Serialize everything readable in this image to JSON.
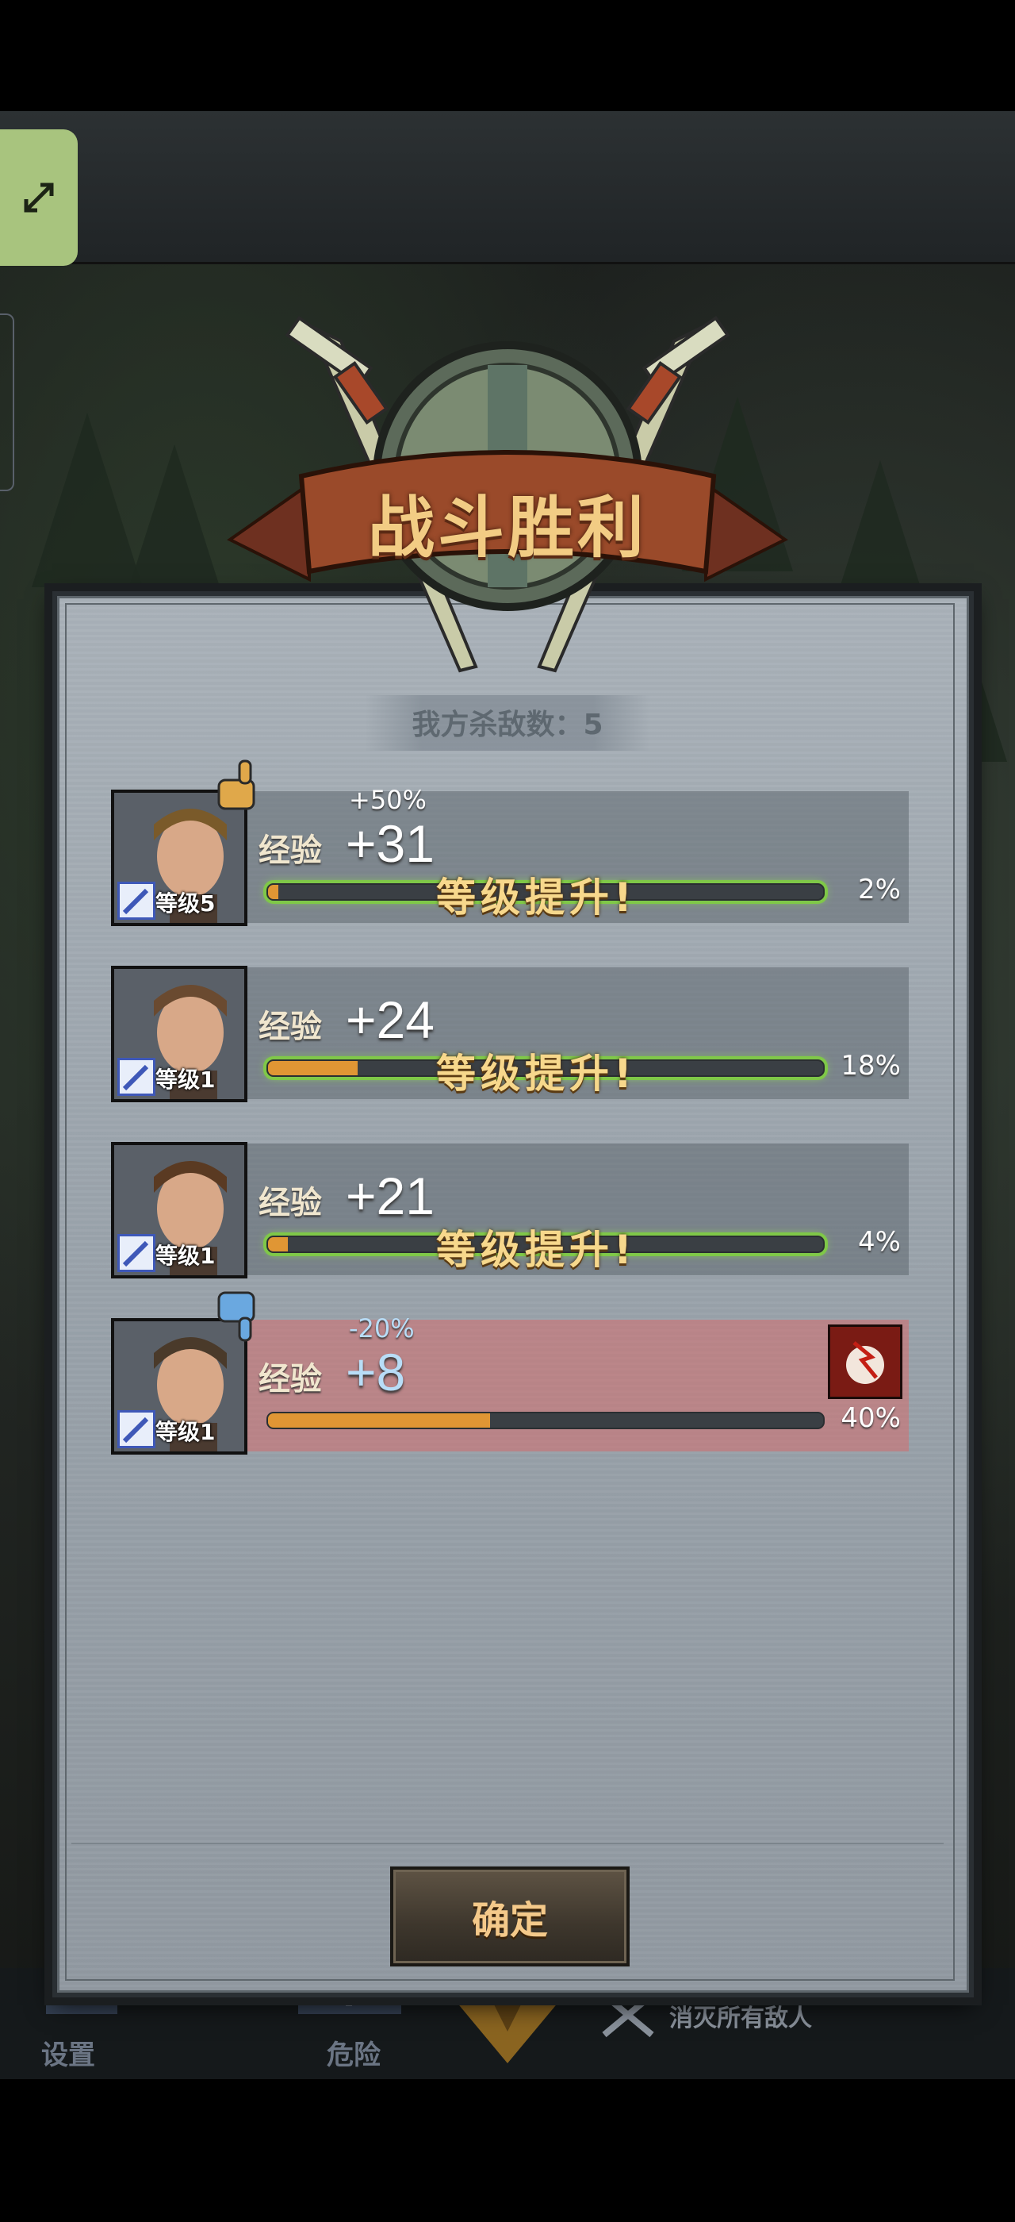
{
  "title": "战斗胜利",
  "kills_label": "我方杀敌数：5",
  "exp_label": "经验",
  "level_up_label": "等级提升!",
  "confirm_label": "确定",
  "heroes": [
    {
      "level": "等级5",
      "bonus": "+50%",
      "gain": "+31",
      "percent": "2%",
      "progress": 0.02,
      "level_up": true,
      "mood": "thumbs-up"
    },
    {
      "level": "等级1",
      "bonus": "",
      "gain": "+24",
      "percent": "18%",
      "progress": 0.18,
      "level_up": true,
      "mood": ""
    },
    {
      "level": "等级1",
      "bonus": "",
      "gain": "+21",
      "percent": "4%",
      "progress": 0.04,
      "level_up": true,
      "mood": ""
    },
    {
      "level": "等级1",
      "bonus": "-20%",
      "gain": "+8",
      "percent": "40%",
      "progress": 0.4,
      "level_up": false,
      "mood": "thumbs-down",
      "status": "injury-icon"
    }
  ],
  "bottom_nav": {
    "settings": "设置",
    "danger": "危险",
    "objective": "消灭所有敌人"
  },
  "colors": {
    "title": "#f2cc84",
    "progress_fill": "#e09634",
    "level_glow": "#7fc848",
    "expand_button": "#a8c47e"
  }
}
